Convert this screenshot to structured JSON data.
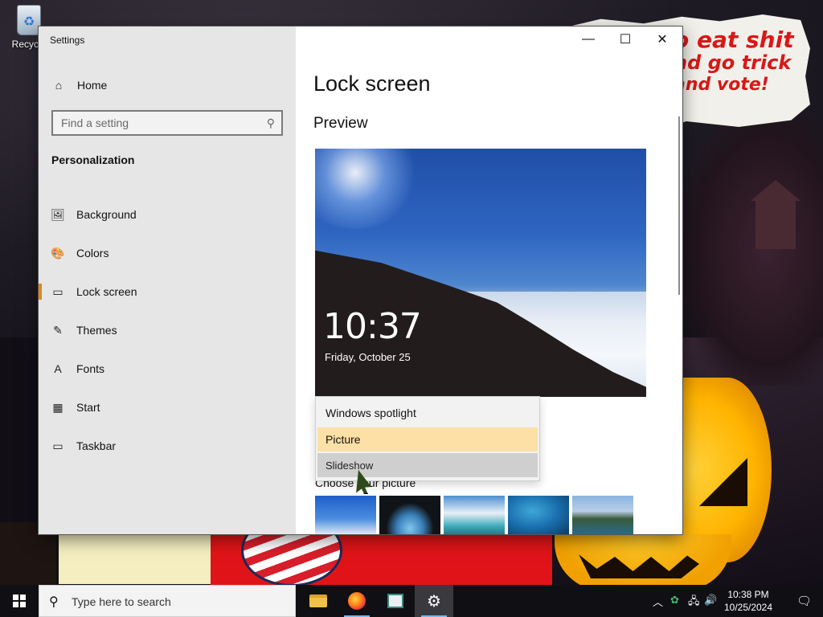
{
  "desktop": {
    "recycle_bin_label": "Recycle",
    "wallpaper_text": [
      "o eat shit",
      "nd go trick",
      "and vote!"
    ]
  },
  "window": {
    "title": "Settings",
    "controls": {
      "minimize": "—",
      "maximize": "☐",
      "close": "✕"
    }
  },
  "sidebar": {
    "home_label": "Home",
    "search_placeholder": "Find a setting",
    "section": "Personalization",
    "items": [
      {
        "label": "Background",
        "icon": "background-icon",
        "glyph": "🖼"
      },
      {
        "label": "Colors",
        "icon": "palette-icon",
        "glyph": "🎨"
      },
      {
        "label": "Lock screen",
        "icon": "lock-screen-icon",
        "glyph": "▭",
        "active": true
      },
      {
        "label": "Themes",
        "icon": "themes-icon",
        "glyph": "✎"
      },
      {
        "label": "Fonts",
        "icon": "fonts-icon",
        "glyph": "A"
      },
      {
        "label": "Start",
        "icon": "start-icon",
        "glyph": "▦"
      },
      {
        "label": "Taskbar",
        "icon": "taskbar-icon",
        "glyph": "▭"
      }
    ]
  },
  "main": {
    "title": "Lock screen",
    "preview_heading": "Preview",
    "preview": {
      "time": "10:37",
      "date": "Friday, October 25"
    },
    "background_dropdown": {
      "options": [
        "Windows spotlight",
        "Picture",
        "Slideshow"
      ],
      "selected": "Picture",
      "hovered": "Slideshow"
    },
    "choose_picture_label": "Choose your picture"
  },
  "taskbar": {
    "search_placeholder": "Type here to search",
    "apps": [
      "File Explorer",
      "Firefox",
      "Notepad",
      "Settings"
    ],
    "clock_time": "10:38 PM",
    "clock_date": "10/25/2024"
  },
  "colors": {
    "accent": "#d98a1a",
    "selected_option_bg": "#fce0a6",
    "hover_option_bg": "#cfcfcf"
  }
}
